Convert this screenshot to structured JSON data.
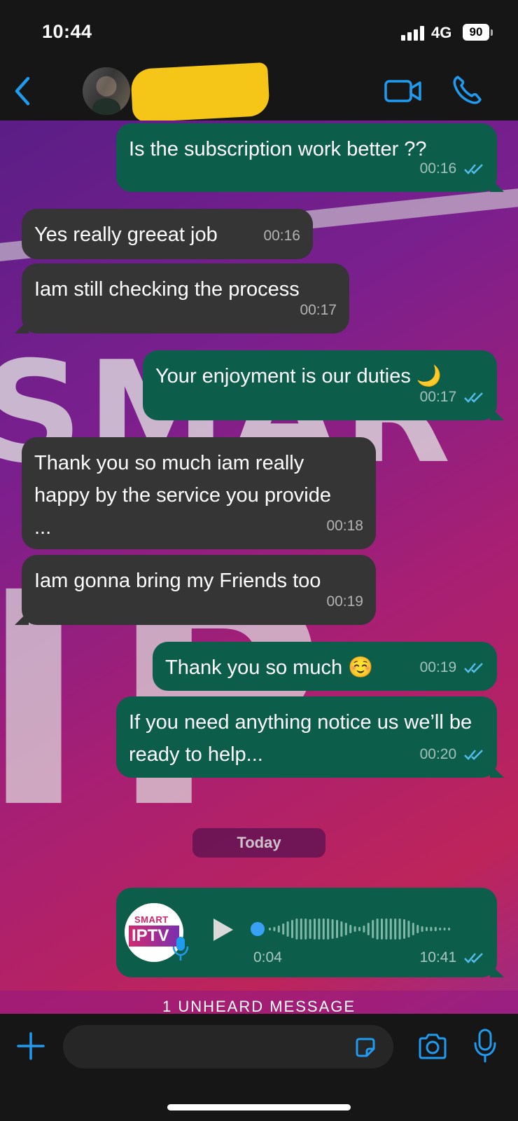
{
  "status_bar": {
    "time": "10:44",
    "network": "4G",
    "battery": "90"
  },
  "header": {
    "contact_name": ""
  },
  "background_watermark": {
    "line1": "SMAR",
    "line2": "IP"
  },
  "messages": [
    {
      "direction": "out",
      "text": "Is the subscription work better ??",
      "time": "00:16",
      "read": true
    },
    {
      "direction": "in",
      "text": "Yes really greeat job",
      "time": "00:16"
    },
    {
      "direction": "in",
      "text": "Iam still checking the process",
      "time": "00:17"
    },
    {
      "direction": "out",
      "text": "Your enjoyment is our duties 🌙",
      "time": "00:17",
      "read": true
    },
    {
      "direction": "in",
      "text": "Thank you so much iam really happy by  the service you provide ...",
      "time": "00:18"
    },
    {
      "direction": "in",
      "text": "Iam gonna bring my Friends too",
      "time": "00:19"
    },
    {
      "direction": "out",
      "text": "Thank you so much ☺️",
      "time": "00:19",
      "read": true
    },
    {
      "direction": "out",
      "text": "If you need anything notice us we’ll be ready to help...",
      "time": "00:20",
      "read": true
    }
  ],
  "day_separator": "Today",
  "voice_message": {
    "logo_top": "SMART",
    "logo_main": "IPTV",
    "duration": "0:04",
    "time": "10:41",
    "read": true
  },
  "unheard_banner": "1 UNHEARD MESSAGE",
  "icons": {
    "back": "chevron-left-icon",
    "video": "video-camera-icon",
    "call": "phone-icon",
    "plus": "plus-icon",
    "sticker": "sticker-icon",
    "camera": "camera-icon",
    "mic": "microphone-icon"
  },
  "colors": {
    "accent": "#1f9bf0",
    "outgoing_bubble": "#0c5e4b",
    "incoming_bubble": "#353535",
    "read_ticks": "#53bdeb"
  }
}
